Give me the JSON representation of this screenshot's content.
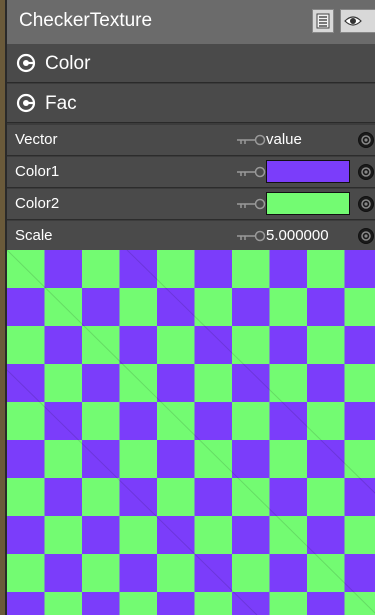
{
  "node": {
    "title": "CheckerTexture",
    "outputs": [
      {
        "label": "Color"
      },
      {
        "label": "Fac"
      }
    ],
    "inputs": {
      "vector": {
        "label": "Vector",
        "value": "value"
      },
      "color1": {
        "label": "Color1",
        "color": "#7b3dfa"
      },
      "color2": {
        "label": "Color2",
        "color": "#73fb72"
      },
      "scale": {
        "label": "Scale",
        "value": "5.000000"
      }
    }
  },
  "icons": {
    "header_left": "list-icon",
    "header_right": "eye-icon",
    "output_socket": "output-socket-icon",
    "key": "key-icon",
    "input_socket": "input-socket-icon"
  },
  "colors": {
    "header_bg": "#6b6b6b",
    "row_bg": "#4a4a4a",
    "checker_a": "#7b3dfa",
    "checker_b": "#73fb72"
  }
}
